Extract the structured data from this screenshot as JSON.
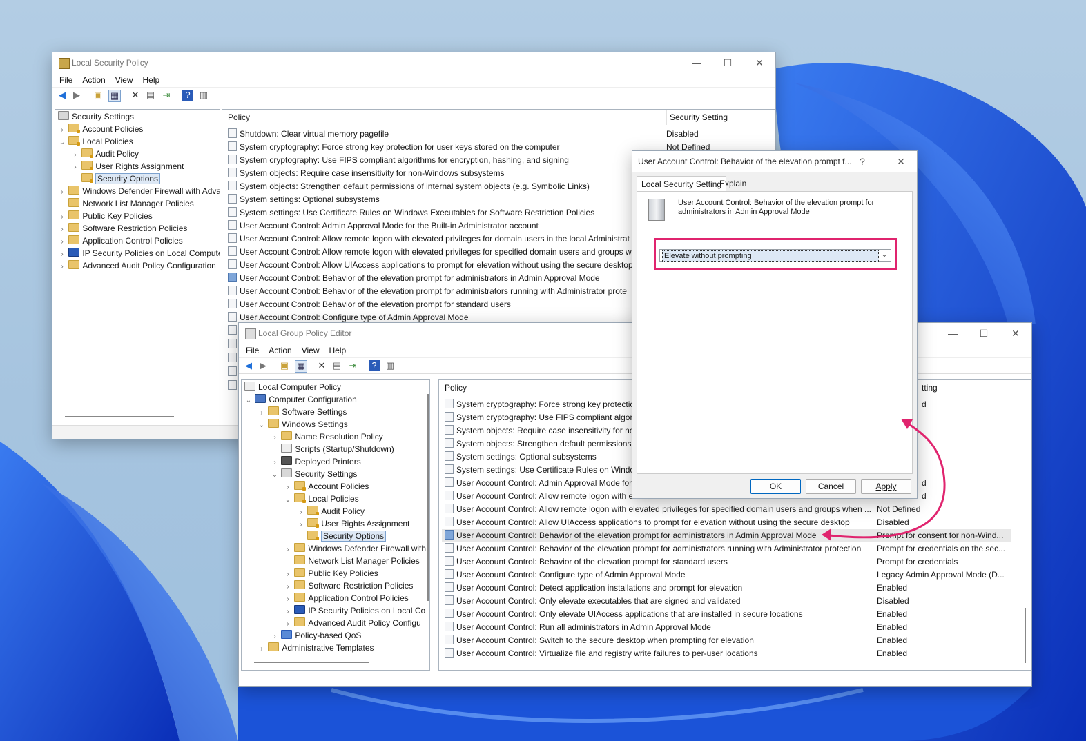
{
  "colors": {
    "accent": "#0067c0",
    "highlight_annotation": "#e0246e",
    "desktop": "#a6c4df",
    "swirl": "#1b53d8"
  },
  "lsp": {
    "title": "Local Security Policy",
    "menu": [
      "File",
      "Action",
      "View",
      "Help"
    ],
    "tree": [
      {
        "label": "Security Settings"
      },
      {
        "label": "Account Policies"
      },
      {
        "label": "Local Policies"
      },
      {
        "label": "Audit Policy"
      },
      {
        "label": "User Rights Assignment"
      },
      {
        "label": "Security Options"
      },
      {
        "label": "Windows Defender Firewall with Adva"
      },
      {
        "label": "Network List Manager Policies"
      },
      {
        "label": "Public Key Policies"
      },
      {
        "label": "Software Restriction Policies"
      },
      {
        "label": "Application Control Policies"
      },
      {
        "label": "IP Security Policies on Local Compute"
      },
      {
        "label": "Advanced Audit Policy Configuration"
      }
    ],
    "col_policy": "Policy",
    "col_setting": "Security Setting",
    "rows": [
      "Shutdown: Clear virtual memory pagefile",
      "System cryptography: Force strong key protection for user keys stored on the computer",
      "System cryptography: Use FIPS compliant algorithms for encryption, hashing, and signing",
      "System objects: Require case insensitivity for non-Windows subsystems",
      "System objects: Strengthen default permissions of internal system objects (e.g. Symbolic Links)",
      "System settings: Optional subsystems",
      "System settings: Use Certificate Rules on Windows Executables for Software Restriction Policies",
      "User Account Control: Admin Approval Mode for the Built-in Administrator account",
      "User Account Control: Allow remote logon with elevated privileges for domain users in the local Administrat",
      "User Account Control: Allow remote logon with elevated privileges for specified domain users and groups wh",
      "User Account Control: Allow UIAccess applications to prompt for elevation without using the secure desktop",
      "User Account Control: Behavior of the elevation prompt for administrators in Admin Approval Mode",
      "User Account Control: Behavior of the elevation prompt for administrators running with Administrator prote",
      "User Account Control: Behavior of the elevation prompt for standard users",
      "User Account Control: Configure type of Admin Approval Mode"
    ],
    "values": [
      "Disabled",
      "Not Defined"
    ]
  },
  "gpe": {
    "title": "Local Group Policy Editor",
    "menu": [
      "File",
      "Action",
      "View",
      "Help"
    ],
    "tree": [
      {
        "label": "Local Computer Policy"
      },
      {
        "label": "Computer Configuration"
      },
      {
        "label": "Software Settings"
      },
      {
        "label": "Windows Settings"
      },
      {
        "label": "Name Resolution Policy"
      },
      {
        "label": "Scripts (Startup/Shutdown)"
      },
      {
        "label": "Deployed Printers"
      },
      {
        "label": "Security Settings"
      },
      {
        "label": "Account Policies"
      },
      {
        "label": "Local Policies"
      },
      {
        "label": "Audit Policy"
      },
      {
        "label": "User Rights Assignment"
      },
      {
        "label": "Security Options"
      },
      {
        "label": "Windows Defender Firewall with"
      },
      {
        "label": "Network List Manager Policies"
      },
      {
        "label": "Public Key Policies"
      },
      {
        "label": "Software Restriction Policies"
      },
      {
        "label": "Application Control Policies"
      },
      {
        "label": "IP Security Policies on Local Co"
      },
      {
        "label": "Advanced Audit Policy Configu"
      },
      {
        "label": "Policy-based QoS"
      },
      {
        "label": "Administrative Templates"
      }
    ],
    "col_policy": "Policy",
    "col_setting_partial": "tting",
    "rows": [
      {
        "policy": "System cryptography: Force strong key protectio",
        "value": "d"
      },
      {
        "policy": "System cryptography: Use FIPS compliant algorit",
        "value": ""
      },
      {
        "policy": "System objects: Require case insensitivity for non",
        "value": ""
      },
      {
        "policy": "System objects: Strengthen default permissions o",
        "value": ""
      },
      {
        "policy": "System settings: Optional subsystems",
        "value": ""
      },
      {
        "policy": "System settings: Use Certificate Rules on Window",
        "value": ""
      },
      {
        "policy": "User Account Control: Admin Approval Mode for",
        "value": "d"
      },
      {
        "policy": "User Account Control: Allow remote logon with e",
        "value": "d"
      },
      {
        "policy": "User Account Control: Allow remote logon with elevated privileges for specified domain users and groups when ...",
        "value": "Not Defined"
      },
      {
        "policy": "User Account Control: Allow UIAccess applications to prompt for elevation without using the secure desktop",
        "value": "Disabled"
      },
      {
        "policy": "User Account Control: Behavior of the elevation prompt for administrators in Admin Approval Mode",
        "value": "Prompt for consent for non-Wind..."
      },
      {
        "policy": "User Account Control: Behavior of the elevation prompt for administrators running with Administrator protection",
        "value": "Prompt for credentials on the sec..."
      },
      {
        "policy": "User Account Control: Behavior of the elevation prompt for standard users",
        "value": "Prompt for credentials"
      },
      {
        "policy": "User Account Control: Configure type of Admin Approval Mode",
        "value": "Legacy Admin Approval Mode (D..."
      },
      {
        "policy": "User Account Control: Detect application installations and prompt for elevation",
        "value": "Enabled"
      },
      {
        "policy": "User Account Control: Only elevate executables that are signed and validated",
        "value": "Disabled"
      },
      {
        "policy": "User Account Control: Only elevate UIAccess applications that are installed in secure locations",
        "value": "Enabled"
      },
      {
        "policy": "User Account Control: Run all administrators in Admin Approval Mode",
        "value": "Enabled"
      },
      {
        "policy": "User Account Control: Switch to the secure desktop when prompting for elevation",
        "value": "Enabled"
      },
      {
        "policy": "User Account Control: Virtualize file and registry write failures to per-user locations",
        "value": "Enabled"
      }
    ]
  },
  "dialog": {
    "title": "User Account Control: Behavior of the elevation prompt f...",
    "help": "?",
    "close": "✕",
    "tabs": [
      "Local Security Setting",
      "Explain"
    ],
    "description": "User Account Control: Behavior of the elevation prompt for administrators in Admin Approval Mode",
    "dropdown_value": "Elevate without prompting",
    "ok": "OK",
    "cancel": "Cancel",
    "apply": "Apply"
  },
  "glyphs": {
    "minimize": "—",
    "maximize": "☐",
    "close": "✕",
    "expanded": "⌄",
    "collapsed": "›",
    "dropdown": "⌄"
  }
}
